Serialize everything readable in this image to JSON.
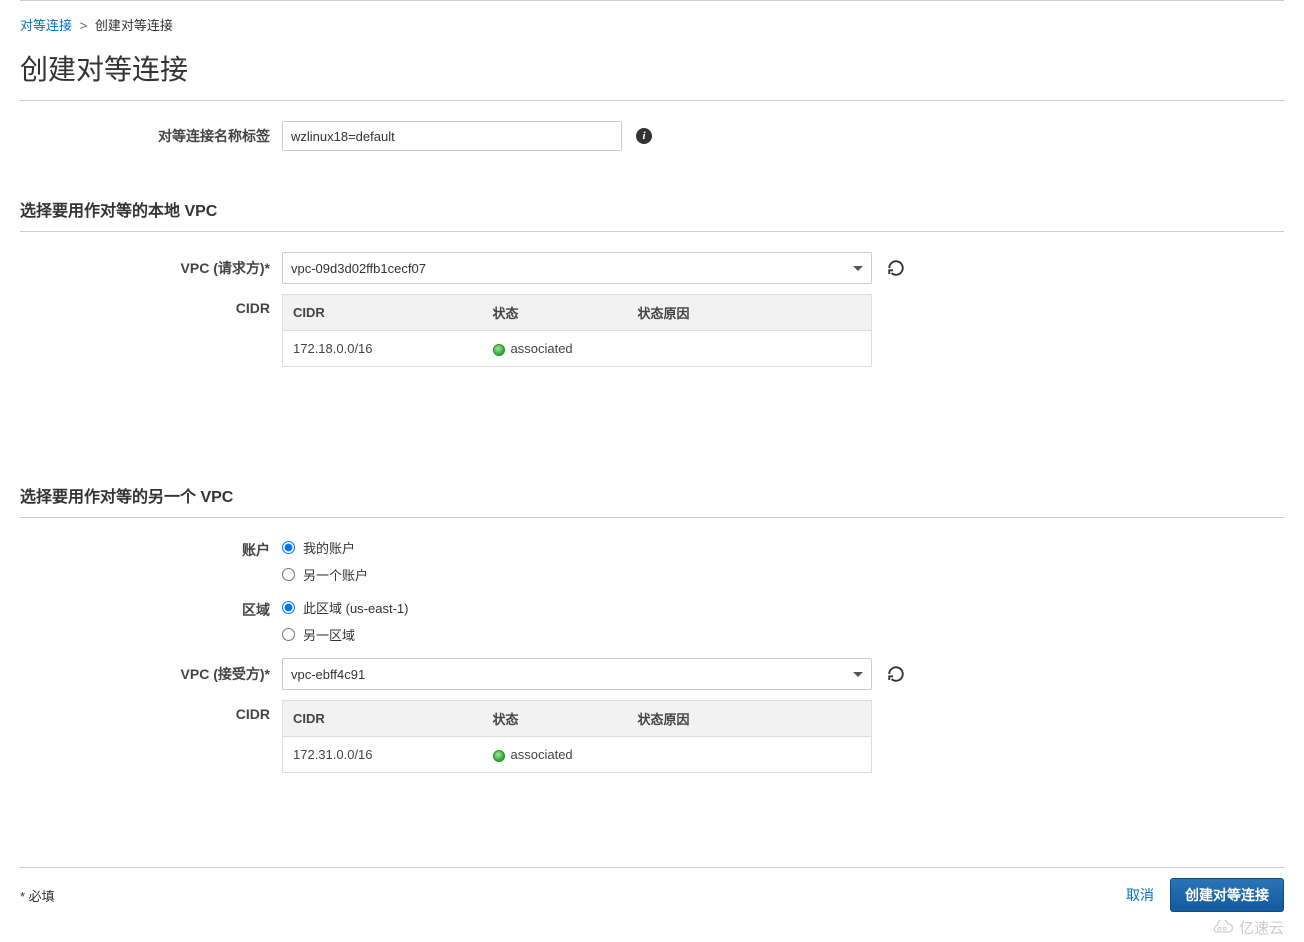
{
  "breadcrumb": {
    "link_label": "对等连接",
    "sep": ">",
    "current": "创建对等连接"
  },
  "page_title": "创建对等连接",
  "name_tag": {
    "label": "对等连接名称标签",
    "value": "wzlinux18=default"
  },
  "local_vpc": {
    "header": "选择要用作对等的本地 VPC",
    "vpc_label": "VPC (请求方)*",
    "vpc_value": "vpc-09d3d02ffb1cecf07",
    "cidr_label": "CIDR",
    "table": {
      "headers": {
        "cidr": "CIDR",
        "status": "状态",
        "reason": "状态原因"
      },
      "rows": [
        {
          "cidr": "172.18.0.0/16",
          "status": "associated",
          "reason": ""
        }
      ]
    }
  },
  "peer_vpc": {
    "header": "选择要用作对等的另一个 VPC",
    "account_label": "账户",
    "account_options": {
      "mine": "我的账户",
      "other": "另一个账户"
    },
    "region_label": "区域",
    "region_options": {
      "this": "此区域 (us-east-1)",
      "other": "另一区域"
    },
    "vpc_label": "VPC (接受方)*",
    "vpc_value": "vpc-ebff4c91",
    "cidr_label": "CIDR",
    "table": {
      "headers": {
        "cidr": "CIDR",
        "status": "状态",
        "reason": "状态原因"
      },
      "rows": [
        {
          "cidr": "172.31.0.0/16",
          "status": "associated",
          "reason": ""
        }
      ]
    }
  },
  "footer": {
    "required_note": "* 必填",
    "cancel_label": "取消",
    "submit_label": "创建对等连接"
  },
  "watermark": "亿速云"
}
